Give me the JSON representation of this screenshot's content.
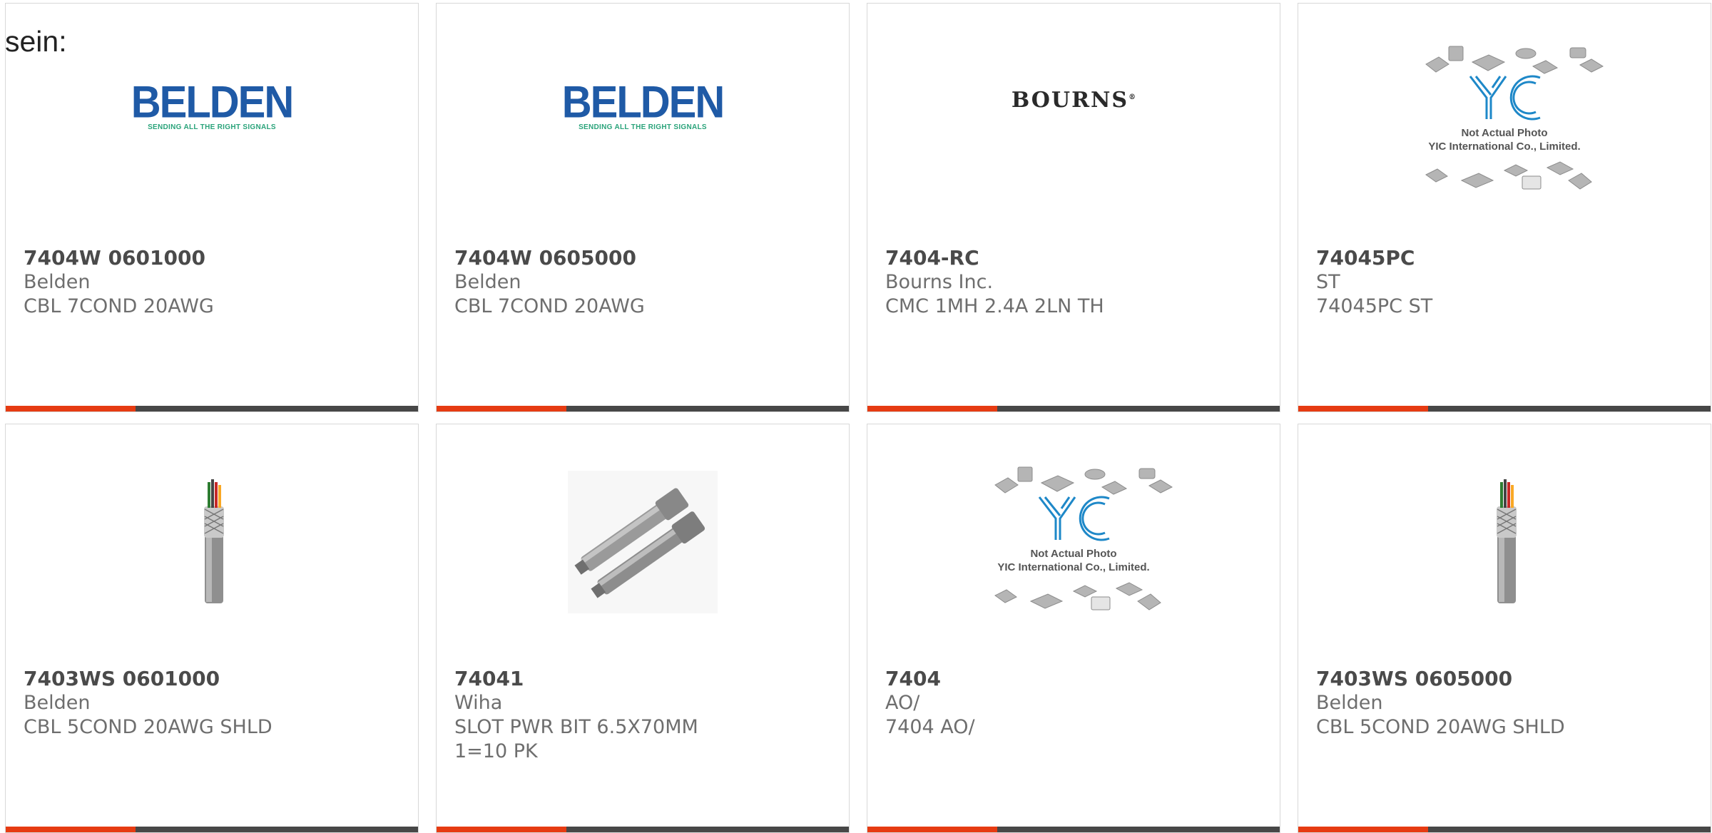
{
  "intro_text": "sein:",
  "products": [
    {
      "part_number": "7404W 0601000",
      "manufacturer": "Belden",
      "description": "CBL 7COND 20AWG",
      "image": "belden-logo"
    },
    {
      "part_number": "7404W 0605000",
      "manufacturer": "Belden",
      "description": "CBL 7COND 20AWG",
      "image": "belden-logo"
    },
    {
      "part_number": "7404-RC",
      "manufacturer": "Bourns Inc.",
      "description": "CMC 1MH 2.4A 2LN TH",
      "image": "bourns-logo"
    },
    {
      "part_number": "74045PC",
      "manufacturer": "ST",
      "description": "74045PC ST",
      "image": "yic-placeholder"
    },
    {
      "part_number": "7403WS 0601000",
      "manufacturer": "Belden",
      "description": "CBL 5COND 20AWG SHLD",
      "image": "cable-photo"
    },
    {
      "part_number": "74041",
      "manufacturer": "Wiha",
      "description": "SLOT PWR BIT 6.5X70MM 1=10 PK",
      "image": "screwdriver-bits-photo"
    },
    {
      "part_number": "7404",
      "manufacturer": "AO/",
      "description": "7404 AO/",
      "image": "yic-placeholder"
    },
    {
      "part_number": "7403WS 0605000",
      "manufacturer": "Belden",
      "description": "CBL 5COND 20AWG SHLD",
      "image": "cable-photo"
    }
  ],
  "logos": {
    "belden_word": "BELDEN",
    "belden_tagline": "SENDING ALL THE RIGHT SIGNALS",
    "bourns_word": "BOURNS",
    "yic_line1": "Not Actual Photo",
    "yic_line2": "YIC International Co., Limited."
  },
  "colors": {
    "accent": "#e63b12",
    "bar": "#474747",
    "belden_blue": "#1f5aa6",
    "belden_green": "#2aa37a",
    "yic_blue": "#1e88c8"
  }
}
